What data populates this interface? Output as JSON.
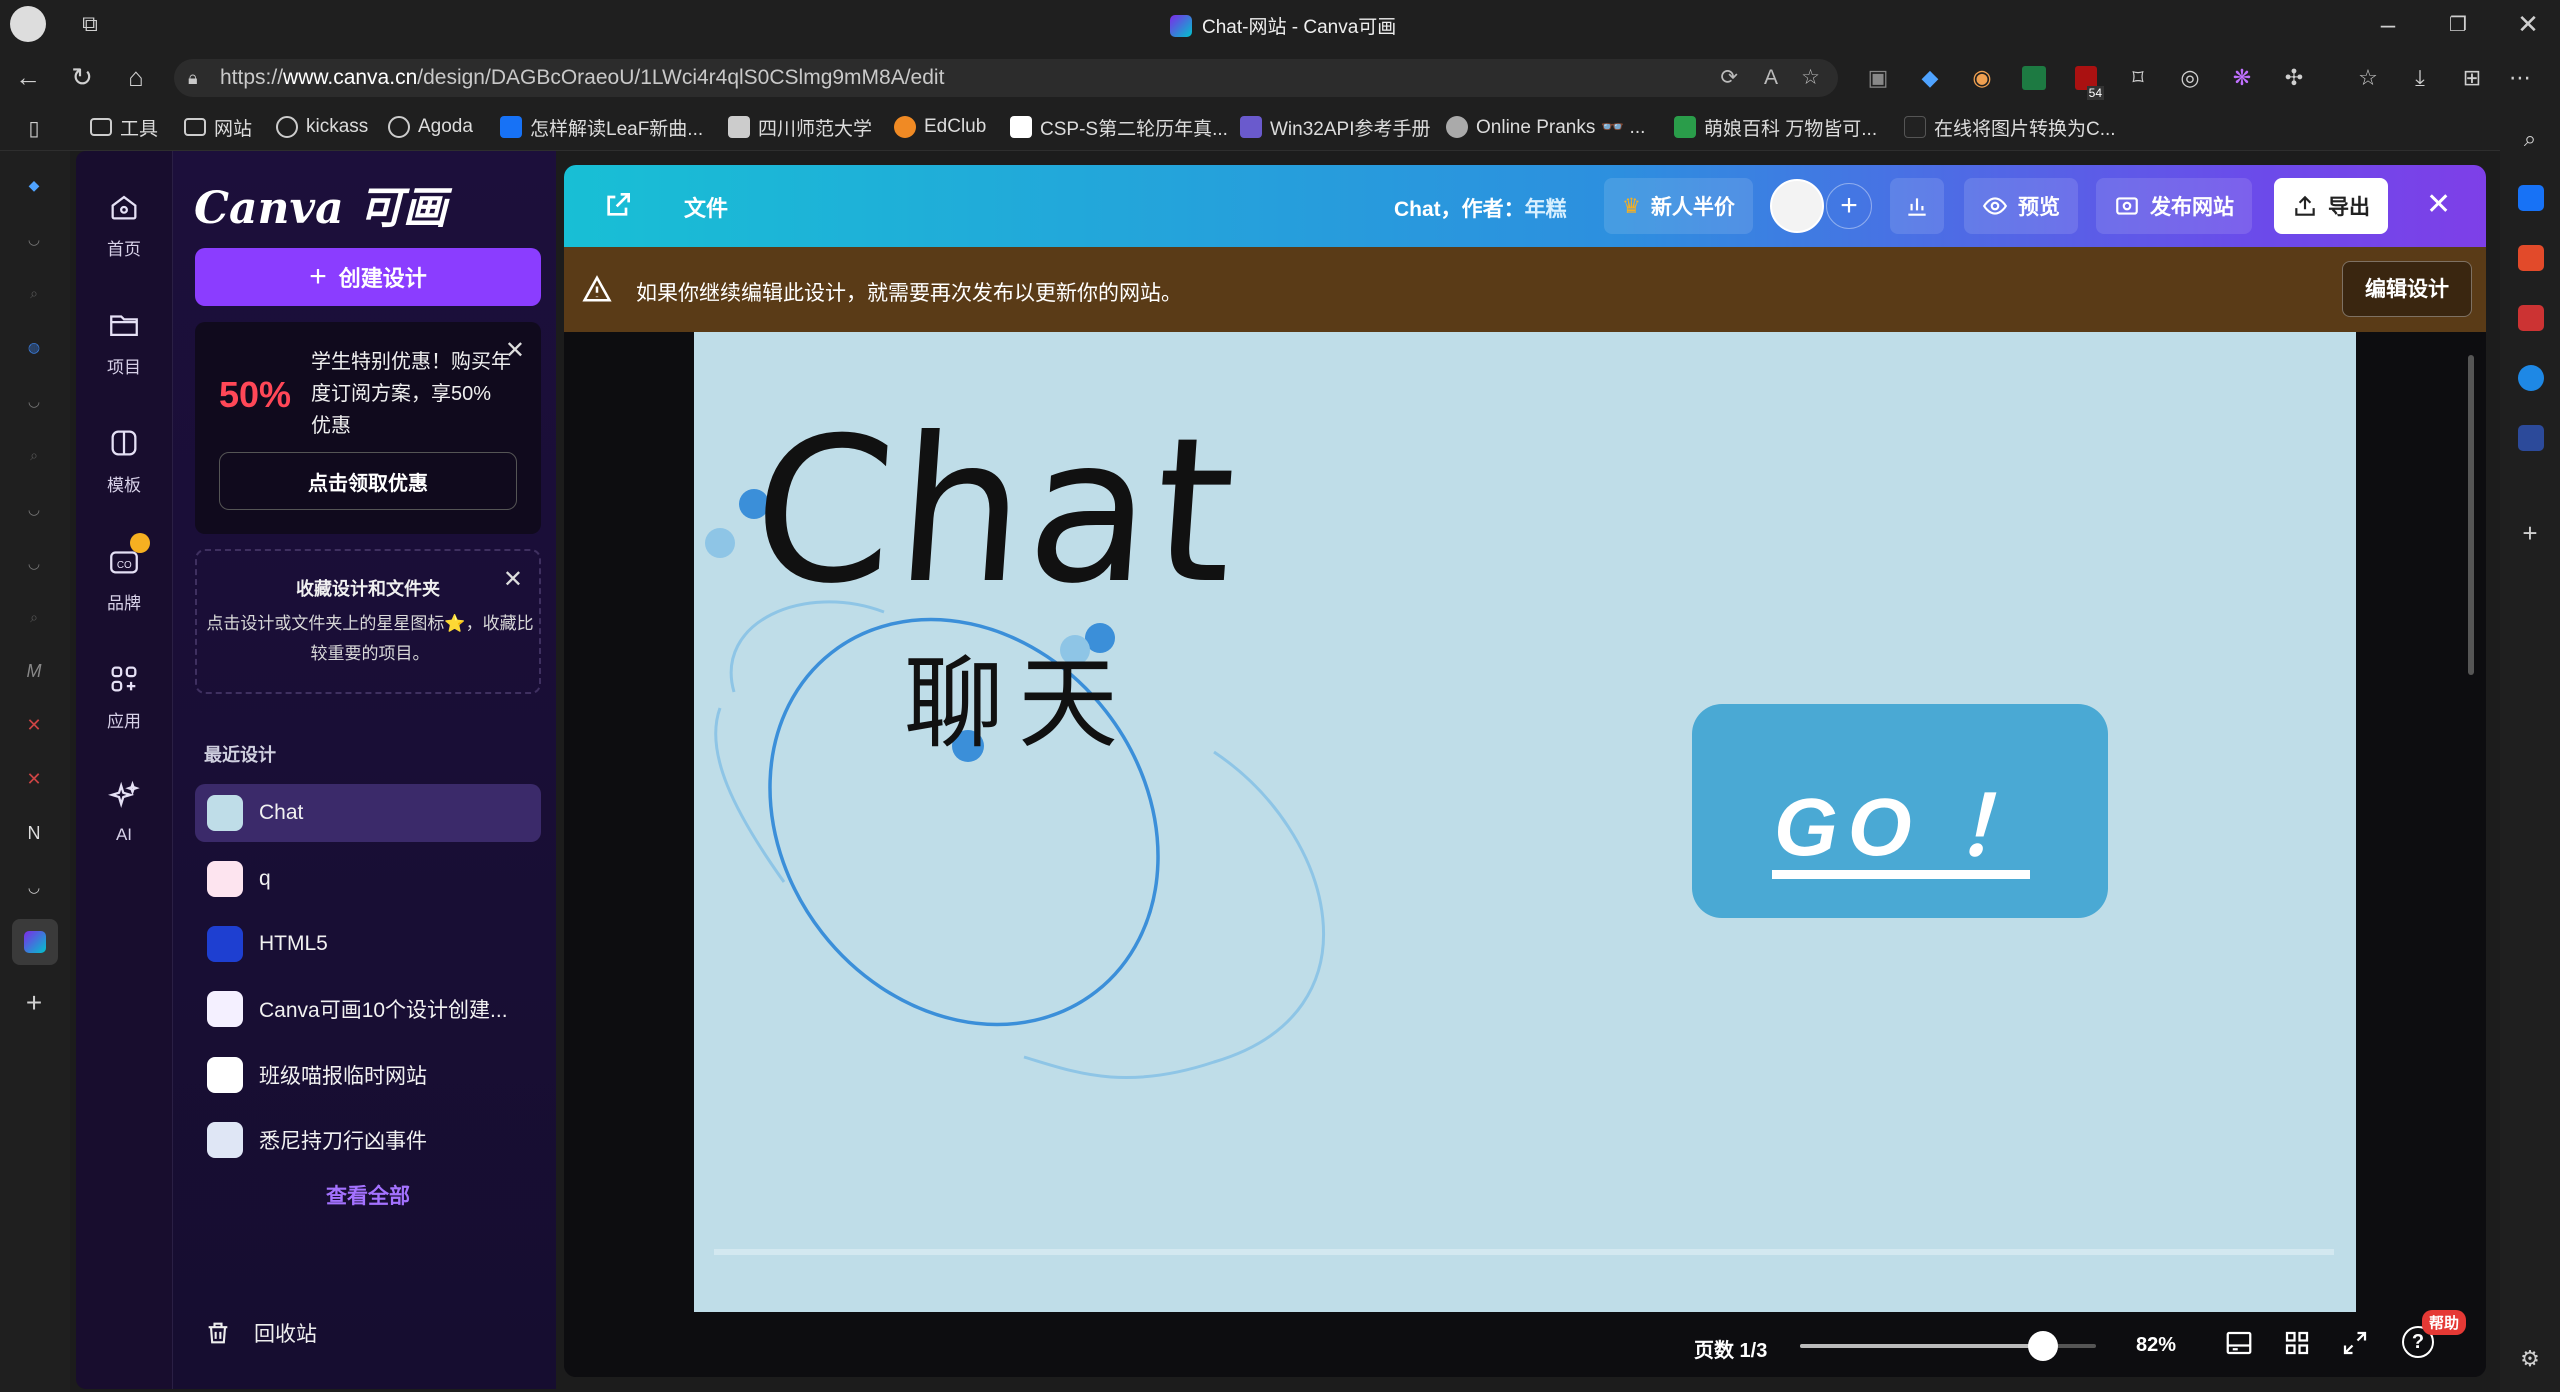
{
  "window": {
    "title": "Chat-网站 - Canva可画"
  },
  "browser": {
    "url_prefix": "https://",
    "url_host": "www.canva.cn",
    "url_path": "/design/DAGBcOraeoU/1LWci4r4qlS0CSlmg9mM8A/edit",
    "ext_badge": "54"
  },
  "bookmarks": [
    {
      "label": "工具",
      "icon": "folder-icon"
    },
    {
      "label": "网站",
      "icon": "folder-icon"
    },
    {
      "label": "kickass",
      "icon": "globe-icon"
    },
    {
      "label": "Agoda",
      "icon": "globe-icon"
    },
    {
      "label": "怎样解读LeaF新曲...",
      "icon": "zhihu-icon"
    },
    {
      "label": "四川师范大学",
      "icon": "school-icon"
    },
    {
      "label": "EdClub",
      "icon": "edclub-icon"
    },
    {
      "label": "CSP-S第二轮历年真...",
      "icon": "csp-icon"
    },
    {
      "label": "Win32API参考手册",
      "icon": "win32-icon"
    },
    {
      "label": "Online Pranks 👓 ...",
      "icon": "pranks-icon"
    },
    {
      "label": "萌娘百科 万物皆可...",
      "icon": "moegirl-icon"
    },
    {
      "label": "在线将图片转换为C...",
      "icon": "convert-icon"
    }
  ],
  "rail": [
    {
      "label": "首页",
      "icon": "home-icon"
    },
    {
      "label": "项目",
      "icon": "folder-icon"
    },
    {
      "label": "模板",
      "icon": "template-icon"
    },
    {
      "label": "品牌",
      "icon": "brand-icon"
    },
    {
      "label": "应用",
      "icon": "apps-icon"
    },
    {
      "label": "AI",
      "icon": "sparkle-icon"
    }
  ],
  "panel": {
    "logo": "Canva 可画",
    "create_label": "创建设计",
    "promo": {
      "percent": "50%",
      "text": "学生特别优惠！购买年度订阅方案，享50%优惠",
      "button": "点击领取优惠"
    },
    "favorites": {
      "title": "收藏设计和文件夹",
      "desc": "点击设计或文件夹上的星星图标⭐，收藏比较重要的项目。"
    },
    "recent_heading": "最近设计",
    "recent": [
      {
        "label": "Chat",
        "active": true
      },
      {
        "label": "q",
        "active": false
      },
      {
        "label": "HTML5",
        "active": false
      },
      {
        "label": "Canva可画10个设计创建...",
        "active": false
      },
      {
        "label": "班级喵报临时网站",
        "active": false
      },
      {
        "label": "悉尼持刀行凶事件",
        "active": false
      }
    ],
    "view_all": "查看全部",
    "trash": "回收站"
  },
  "editor": {
    "file_label": "文件",
    "doc_name": "Chat",
    "author_label": "作者：",
    "author": "年糕",
    "promo_button": "新人半价",
    "preview_label": "预览",
    "publish_label": "发布网站",
    "export_label": "导出",
    "warning": "如果你继续编辑此设计，就需要再次发布以更新你的网站。",
    "edit_design": "编辑设计",
    "page_indicator": "页数 1/3",
    "zoom": "82%",
    "zoom_fraction": 0.82,
    "help": "帮助"
  },
  "design": {
    "title": "Chat",
    "subtitle": "聊天",
    "button": "GO ！"
  },
  "colors": {
    "accent": "#8b3dff",
    "canvas_bg": "#bfdde8",
    "go_button": "#4aa9d4",
    "warn_bg": "#5a3b17",
    "orbit": "#3b8fd9"
  }
}
